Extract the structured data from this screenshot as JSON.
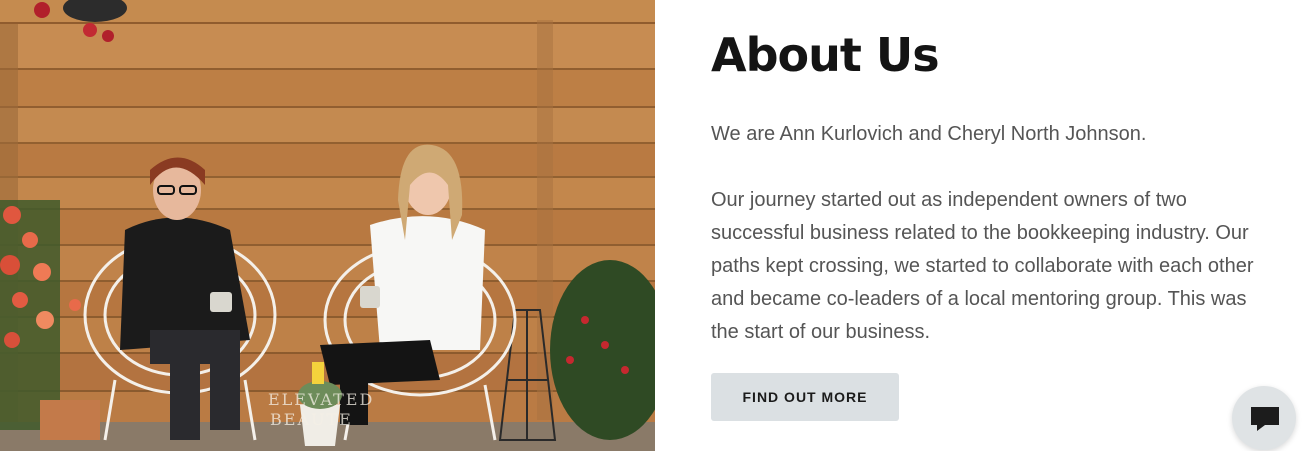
{
  "about": {
    "title": "About Us",
    "intro": "We are Ann Kurlovich and Cheryl North Johnson.",
    "story": "Our journey started out as independent owners of two successful business related to the bookkeeping industry.  Our paths kept crossing, we started to collaborate with each other and became co-leaders of a local mentoring group.  This was the start of our business.",
    "cta_label": "FIND OUT MORE"
  },
  "photo": {
    "watermark_line1": "ELEVATED",
    "watermark_line2": "BEAUTE"
  },
  "chat": {
    "icon": "chat-bubble-icon"
  },
  "colors": {
    "heading": "#141414",
    "body_text": "#555555",
    "button_bg": "#dbe0e3",
    "chat_bg": "#dfe3e5"
  }
}
